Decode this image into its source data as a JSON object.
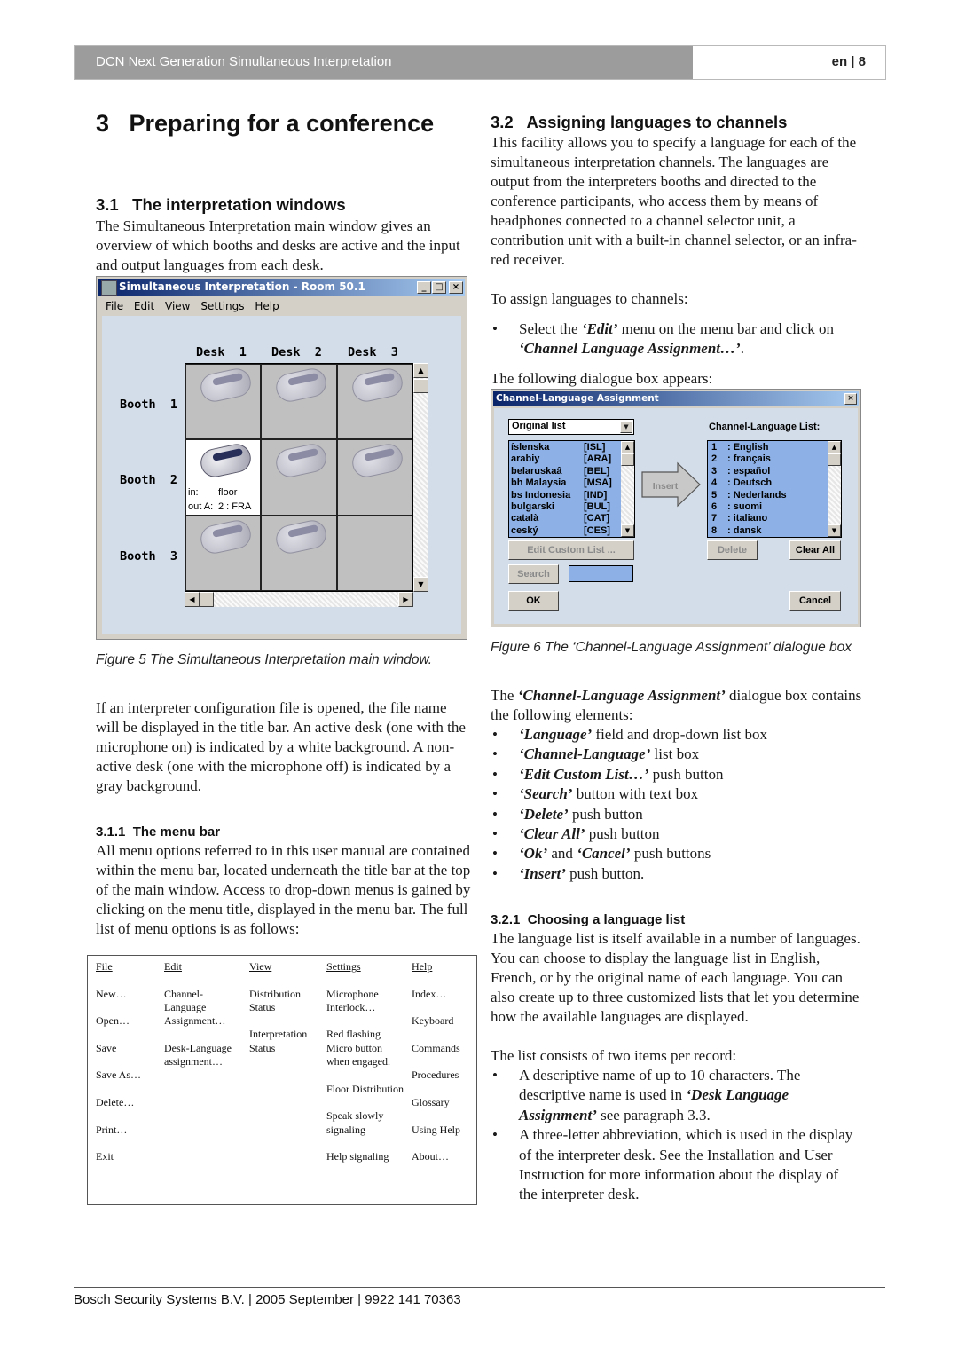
{
  "header": {
    "title": "DCN Next Generation Simultaneous Interpretation",
    "page": "en | 8",
    "colors": {
      "bar": "#9c9c9c",
      "text": "#ffffff"
    }
  },
  "chapter_title": "3   Preparing for a conference",
  "section_3_1": {
    "heading": "3.1   The interpretation windows",
    "intro": "The Simultaneous Interpretation main window gives an overview of which booths and desks are active and the input and output languages from each desk.",
    "figure": {
      "window_title": "Simultaneous Interpretation - Room 50.1",
      "title_buttons": [
        "_",
        "□",
        "×"
      ],
      "menu": [
        "File",
        "Edit",
        "View",
        "Settings",
        "Help"
      ],
      "desk_labels": [
        "Desk  1",
        "Desk  2",
        "Desk  3"
      ],
      "booth_labels": [
        "Booth  1",
        "Booth  2",
        "Booth  3"
      ],
      "cells": [
        {
          "booth": 1,
          "desk": 1,
          "device": true,
          "active": false
        },
        {
          "booth": 1,
          "desk": 2,
          "device": true,
          "active": false
        },
        {
          "booth": 1,
          "desk": 3,
          "device": true,
          "active": false
        },
        {
          "booth": 2,
          "desk": 1,
          "device": true,
          "active": true,
          "in_label": "in:",
          "in_value": "floor",
          "out_label": "out A:",
          "out_value": "2 : FRA"
        },
        {
          "booth": 2,
          "desk": 2,
          "device": true,
          "active": false
        },
        {
          "booth": 2,
          "desk": 3,
          "device": true,
          "active": false
        },
        {
          "booth": 3,
          "desk": 1,
          "device": true,
          "active": false
        },
        {
          "booth": 3,
          "desk": 2,
          "device": true,
          "active": false
        },
        {
          "booth": 3,
          "desk": 3,
          "device": false,
          "active": false
        }
      ],
      "caption": "Figure 5 The Simultaneous Interpretation main window."
    },
    "para2": "If an interpreter configuration file is opened, the file name will be displayed in the title bar. An active desk (one with the microphone on) is indicated by a white background. A non-active desk (one with the microphone off) is indicated by a gray background."
  },
  "section_3_1_1": {
    "heading": "3.1.1  The menu bar",
    "text": "All menu options referred to in this user manual are contained within the menu bar, located underneath the title bar at the top of the main window. Access to drop-down menus is gained by clicking on the menu title, displayed in the menu bar. The full list of menu options is as follows:",
    "menu_table": {
      "columns": [
        {
          "header": "File",
          "items": [
            "New…",
            "Open…",
            "Save",
            "Save As…",
            "Delete…",
            "Print…",
            "Exit"
          ]
        },
        {
          "header": "Edit",
          "items": [
            "Channel-Language Assignment…",
            "Desk-Language assignment…"
          ]
        },
        {
          "header": "View",
          "items": [
            "Distribution Status",
            "Interpretation Status"
          ]
        },
        {
          "header": "Settings",
          "items": [
            "Microphone Interlock…",
            "Red flashing Micro button when engaged.",
            "Floor Distribution",
            "Speak slowly signaling",
            "Help signaling"
          ]
        },
        {
          "header": "Help",
          "items": [
            "Index…",
            "Keyboard",
            "Commands",
            "Procedures",
            "Glossary",
            "Using Help",
            "About…"
          ]
        }
      ]
    }
  },
  "section_3_2": {
    "heading": "3.2   Assigning languages to channels",
    "intro": "This facility allows you to specify a language for each of the simultaneous interpretation channels. The languages are output from the interpreters booths and directed to the conference participants, who access them by means of headphones connected to a channel selector unit, a contribution unit with a built-in channel selector, or an infra-red receiver.",
    "to_assign": "To assign languages to channels:",
    "step": {
      "pre": "Select the ",
      "b1": "‘Edit’",
      "mid": " menu on the menu bar and click on ",
      "b2": "‘Channel Language Assignment…’",
      "post": "."
    },
    "following": "The following dialogue box appears:",
    "dialog": {
      "title": "Channel-Language Assignment",
      "close": "×",
      "list_type": "Original list",
      "languages": [
        {
          "name": "íslenska",
          "code": "[ISL]"
        },
        {
          "name": "arabiy",
          "code": "[ARA]"
        },
        {
          "name": "belaruskaâ",
          "code": "[BEL]"
        },
        {
          "name": "bh Malaysia",
          "code": "[MSA]"
        },
        {
          "name": "bs Indonesia",
          "code": "[IND]"
        },
        {
          "name": "bulgarski",
          "code": "[BUL]"
        },
        {
          "name": "català",
          "code": "[CAT]"
        },
        {
          "name": "ceský",
          "code": "[CES]"
        }
      ],
      "channel_list_label": "Channel-Language List:",
      "channels": [
        {
          "num": "1",
          "lang": ": English"
        },
        {
          "num": "2",
          "lang": ": français"
        },
        {
          "num": "3",
          "lang": ": español"
        },
        {
          "num": "4",
          "lang": ": Deutsch"
        },
        {
          "num": "5",
          "lang": ": Nederlands"
        },
        {
          "num": "6",
          "lang": ": suomi"
        },
        {
          "num": "7",
          "lang": ": italiano"
        },
        {
          "num": "8",
          "lang": ": dansk"
        }
      ],
      "insert": "Insert",
      "edit_custom": "Edit Custom List ...",
      "search": "Search",
      "search_value": "",
      "delete": "Delete",
      "clear_all": "Clear All",
      "ok": "OK",
      "cancel": "Cancel",
      "colors": {
        "list_bg": "#8db1e6",
        "client_bg": "#d3dde9"
      }
    },
    "caption": "Figure 6 The ‘Channel-Language Assignment’ dialogue box",
    "contains": {
      "pre": "The ",
      "b": "‘Channel-Language Assignment’",
      "post": " dialogue box contains the following elements:"
    },
    "elements": [
      {
        "b": "‘Language’",
        "t": " field and drop-down list box"
      },
      {
        "b": "‘Channel-Language’",
        "t": " list box"
      },
      {
        "b": "‘Edit Custom List…’",
        "t": " push button"
      },
      {
        "b": "‘Search’",
        "t": " button with text box"
      },
      {
        "b": "‘Delete’",
        "t": " push button"
      },
      {
        "b": "‘Clear All’",
        "t": " push button"
      },
      {
        "b": "‘Ok’",
        "t": " and ",
        "b2": "‘Cancel’",
        "t2": " push buttons"
      },
      {
        "b": "‘Insert’",
        "t": " push button."
      }
    ]
  },
  "section_3_2_1": {
    "heading": "3.2.1  Choosing a language list",
    "text": "The language list is itself available in a number of languages. You can choose to display the language list in English, French, or by the original name of each language. You can also create up to three customized lists that let you determine how the available languages are displayed.",
    "text2": "The list consists of two items per record:",
    "bullets": [
      {
        "pre": "A descriptive name of up to 10 characters. The descriptive name is used in ",
        "b": "‘Desk Language Assignment’",
        "post": " see paragraph 3.3."
      },
      {
        "pre": "A three-letter abbreviation, which is used in the display of the interpreter desk. See the Installation and User Instruction for more information about the display of the interpreter desk.",
        "b": "",
        "post": ""
      }
    ]
  },
  "footer": "Bosch Security Systems B.V. | 2005 September | 9922 141 70363"
}
